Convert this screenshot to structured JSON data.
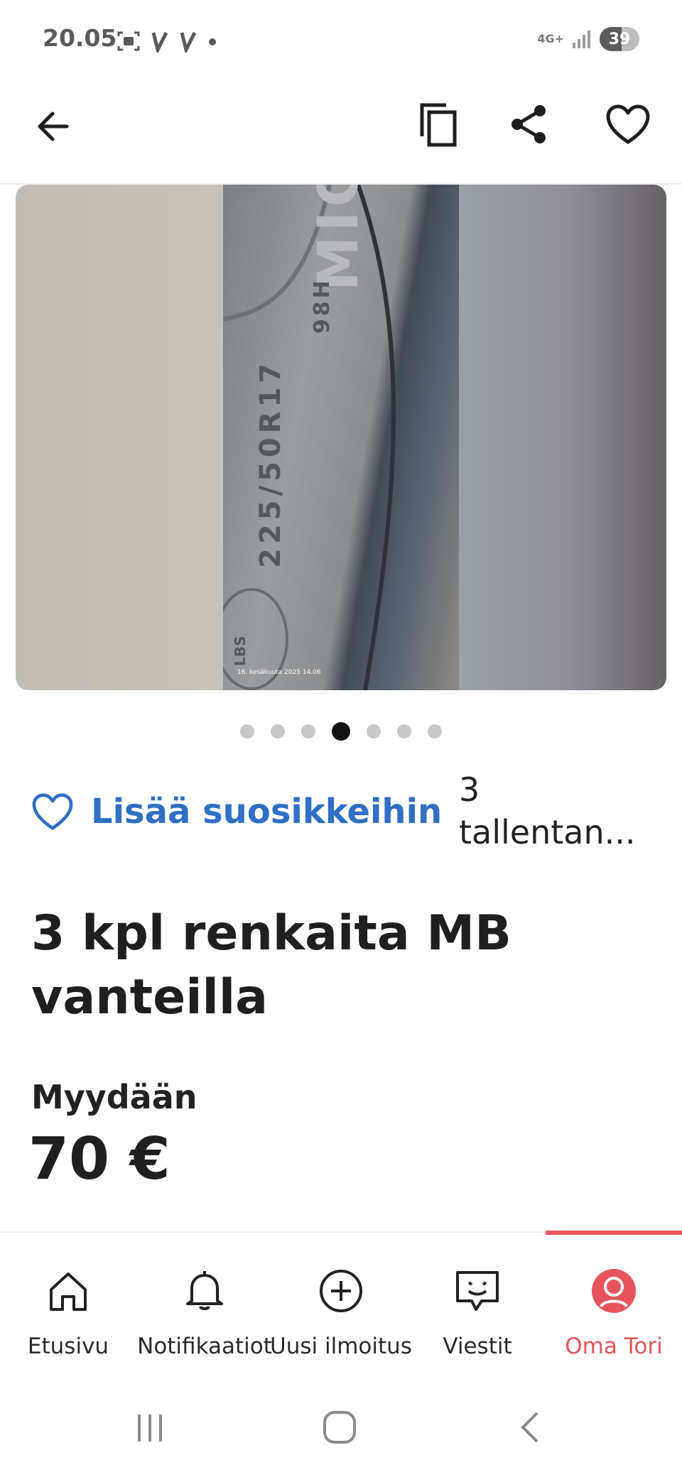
{
  "status_bar": {
    "time": "20.05",
    "network": "4G+",
    "battery": "39"
  },
  "app_bar": {
    "back_icon": "arrow-left-icon",
    "copy_icon": "copy-icon",
    "share_icon": "share-icon",
    "favorite_icon": "heart-outline-icon"
  },
  "image": {
    "tire_brand": "MICHELIN",
    "tire_size": "225/50R17",
    "load_index": "98H",
    "load_unit": "LBS",
    "timestamp": "16. kesäkuuta 2025 14.06",
    "carousel": {
      "count": 7,
      "active_index": 3
    }
  },
  "favorite": {
    "label": "Lisää suosikkeihin",
    "saves_count": "3",
    "saves_text": "tallentan..."
  },
  "listing": {
    "title": "3 kpl renkaita MB vanteilla",
    "sale_type": "Myydään",
    "price": "70 €"
  },
  "bottom_nav": {
    "items": [
      {
        "label": "Etusivu",
        "icon": "home-icon"
      },
      {
        "label": "Notifikaatiot",
        "icon": "bell-icon"
      },
      {
        "label": "Uusi ilmoitus",
        "icon": "plus-circle-icon"
      },
      {
        "label": "Viestit",
        "icon": "chat-icon"
      },
      {
        "label": "Oma Tori",
        "icon": "profile-icon"
      }
    ],
    "active_index": 4
  },
  "colors": {
    "link_blue": "#2f6fc4",
    "accent_red": "#e4525b"
  }
}
